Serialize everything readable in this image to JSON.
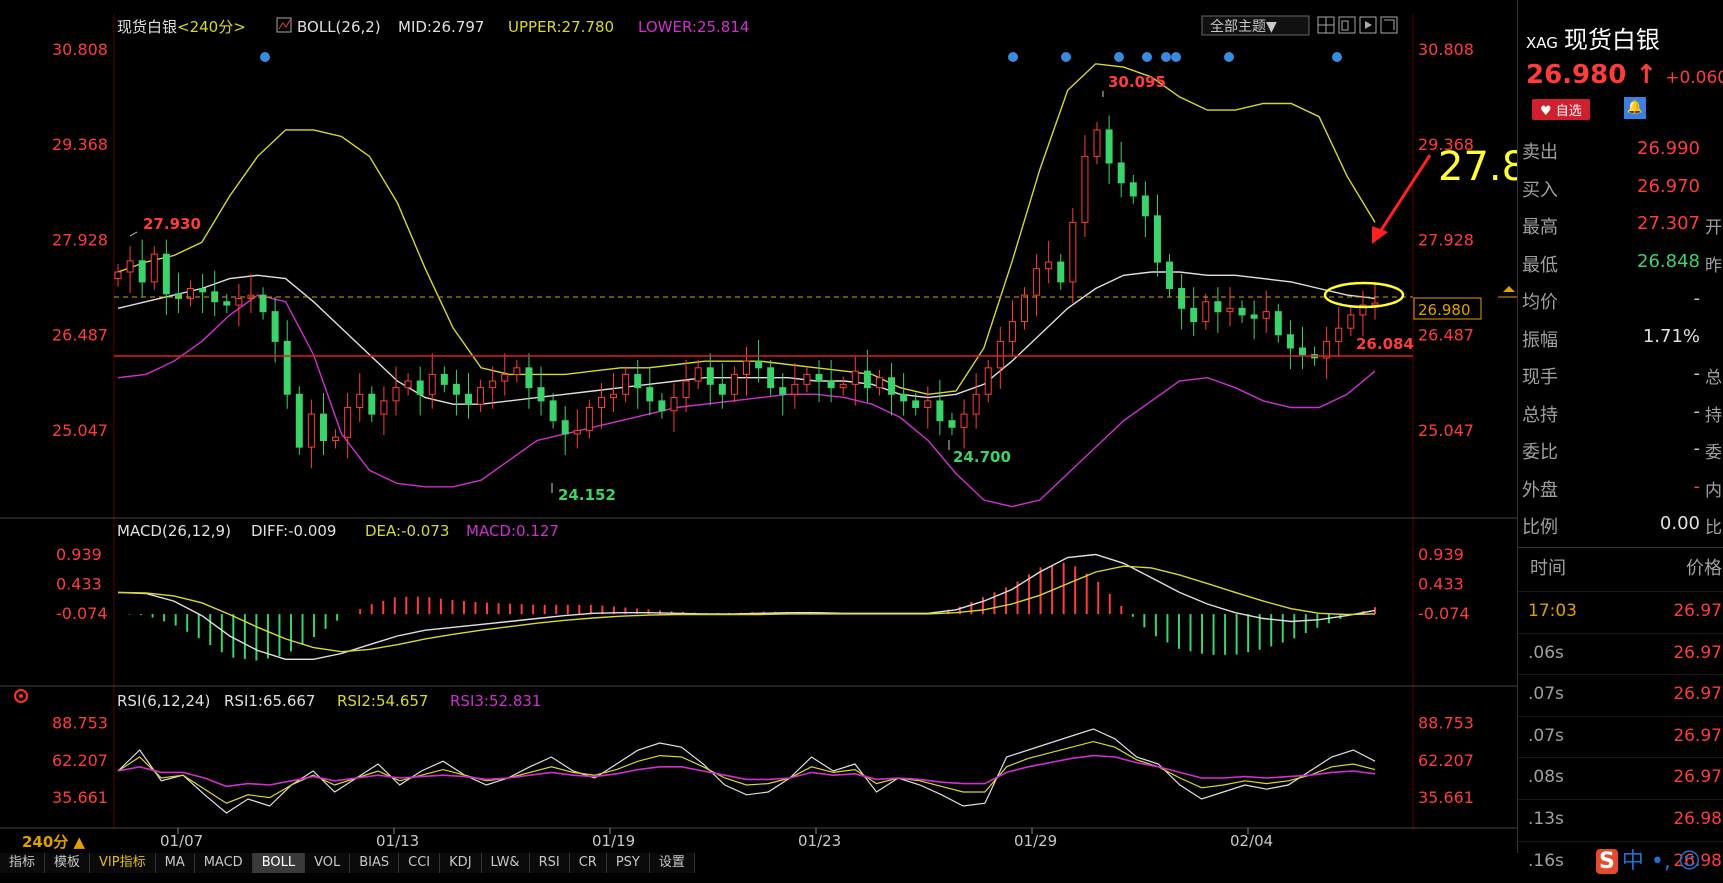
{
  "app": {
    "symbol_code": "XAG",
    "symbol_name": "现货白银",
    "period": "240分",
    "period_label": "<240分>"
  },
  "header_icons": [
    "boll-icon",
    "grid-icon",
    "window-icon",
    "play-icon",
    "expand-icon"
  ],
  "theme_button": "全部主题▼",
  "boll": {
    "label": "BOLL(26,2)",
    "mid": "MID:26.797",
    "upper": "UPPER:27.780",
    "lower": "LOWER:25.814"
  },
  "macd": {
    "label": "MACD(26,12,9)",
    "diff": "DIFF:-0.009",
    "dea": "DEA:-0.073",
    "macd": "MACD:0.127"
  },
  "rsi": {
    "label": "RSI(6,12,24)",
    "rsi1": "RSI1:65.667",
    "rsi2": "RSI2:54.657",
    "rsi3": "RSI3:52.831"
  },
  "period_button": "240分 ▲",
  "annotation": {
    "text": "27.8"
  },
  "tabs": [
    "指标",
    "模板",
    "VIP指标",
    "MA",
    "MACD",
    "BOLL",
    "VOL",
    "BIAS",
    "CCI",
    "KDJ",
    "LW&",
    "RSI",
    "CR",
    "PSY",
    "设置"
  ],
  "active_tab": "BOLL",
  "colors": {
    "up": "#ff3c3c",
    "down": "#3bd36a",
    "upper": "#d8d830",
    "lower": "#d030d0",
    "mid": "#e0e0e0",
    "support": "#e02020",
    "annotation": "#ffff33"
  },
  "chart_data": [
    {
      "type": "candlestick",
      "title": "现货白银<240分>",
      "x_labels": [
        "01/07",
        "01/13",
        "01/19",
        "01/23",
        "01/29",
        "02/04"
      ],
      "y_ticks": [
        "30.808",
        "29.368",
        "27.928",
        "26.487",
        "25.047"
      ],
      "ylim": [
        24.0,
        30.9
      ],
      "markers": {
        "high_27930": "27.930",
        "high_30095": "30.095",
        "low_24152": "24.152",
        "low_24700": "24.700",
        "support": "26.084",
        "current": "26.980"
      },
      "price_series": [
        27.45,
        27.62,
        27.3,
        27.72,
        27.12,
        27.05,
        27.2,
        27.15,
        27.0,
        26.95,
        27.05,
        27.1,
        26.85,
        26.4,
        25.6,
        24.8,
        25.3,
        24.9,
        24.95,
        25.4,
        25.6,
        25.3,
        25.5,
        25.7,
        25.8,
        25.6,
        25.9,
        25.75,
        25.6,
        25.45,
        25.7,
        25.8,
        25.9,
        26.0,
        25.7,
        25.5,
        25.2,
        25.0,
        25.05,
        25.4,
        25.55,
        25.6,
        25.9,
        25.7,
        25.5,
        25.35,
        25.55,
        25.8,
        26.0,
        25.75,
        25.6,
        25.9,
        26.1,
        26.0,
        25.7,
        25.6,
        25.75,
        25.9,
        25.8,
        25.7,
        25.75,
        25.95,
        25.7,
        25.85,
        25.6,
        25.5,
        25.4,
        25.5,
        25.2,
        25.1,
        25.3,
        25.6,
        26.0,
        26.4,
        26.7,
        27.1,
        27.5,
        27.6,
        27.3,
        28.2,
        29.2,
        29.6,
        29.1,
        28.8,
        28.6,
        28.3,
        27.6,
        27.2,
        26.9,
        26.7,
        27.0,
        26.85,
        26.9,
        26.8,
        26.75,
        26.85,
        26.5,
        26.3,
        26.2,
        26.15,
        26.4,
        26.6,
        26.8,
        26.95,
        26.98
      ],
      "boll_upper": [
        27.45,
        27.6,
        27.7,
        27.9,
        28.6,
        29.2,
        29.6,
        29.6,
        29.5,
        29.2,
        28.5,
        27.5,
        26.6,
        26.0,
        25.9,
        25.9,
        25.9,
        25.95,
        26.0,
        26.0,
        26.05,
        26.1,
        26.1,
        26.1,
        26.05,
        26.0,
        25.95,
        25.9,
        25.7,
        25.6,
        25.65,
        26.3,
        27.6,
        29.0,
        30.2,
        30.6,
        30.55,
        30.4,
        30.1,
        29.9,
        29.9,
        30.0,
        30.0,
        29.8,
        28.9,
        28.2
      ],
      "boll_mid": [
        26.9,
        27.0,
        27.1,
        27.2,
        27.35,
        27.4,
        27.35,
        27.0,
        26.6,
        26.2,
        25.8,
        25.55,
        25.45,
        25.45,
        25.5,
        25.55,
        25.6,
        25.65,
        25.7,
        25.75,
        25.8,
        25.85,
        25.85,
        25.85,
        25.85,
        25.8,
        25.8,
        25.75,
        25.6,
        25.55,
        25.6,
        25.75,
        26.1,
        26.5,
        26.9,
        27.2,
        27.4,
        27.45,
        27.45,
        27.4,
        27.4,
        27.35,
        27.3,
        27.2,
        27.1,
        27.05
      ],
      "boll_lower": [
        25.85,
        25.9,
        26.1,
        26.4,
        26.8,
        27.1,
        27.0,
        26.2,
        25.0,
        24.45,
        24.25,
        24.2,
        24.2,
        24.3,
        24.6,
        24.9,
        25.0,
        25.1,
        25.2,
        25.3,
        25.4,
        25.45,
        25.5,
        25.55,
        25.6,
        25.6,
        25.55,
        25.45,
        25.25,
        24.9,
        24.4,
        24.0,
        23.9,
        24.0,
        24.4,
        24.8,
        25.2,
        25.5,
        25.8,
        25.85,
        25.7,
        25.5,
        25.4,
        25.4,
        25.6,
        25.95
      ],
      "macd_ylim": [
        -1.0,
        1.2
      ],
      "macd_ticks": [
        "0.939",
        "0.433",
        "-0.074"
      ],
      "macd_diff": [
        0.3,
        0.28,
        0.15,
        -0.1,
        -0.45,
        -0.7,
        -0.85,
        -0.85,
        -0.75,
        -0.6,
        -0.45,
        -0.35,
        -0.3,
        -0.25,
        -0.2,
        -0.15,
        -0.1,
        -0.06,
        -0.05,
        -0.05,
        -0.06,
        -0.07,
        -0.07,
        -0.06,
        -0.05,
        -0.05,
        -0.06,
        -0.06,
        -0.06,
        -0.06,
        0.0,
        0.15,
        0.35,
        0.65,
        0.9,
        0.95,
        0.8,
        0.55,
        0.3,
        0.1,
        -0.05,
        -0.15,
        -0.2,
        -0.17,
        -0.1,
        -0.01
      ],
      "macd_dea": [
        0.3,
        0.29,
        0.24,
        0.12,
        -0.08,
        -0.3,
        -0.5,
        -0.65,
        -0.72,
        -0.68,
        -0.6,
        -0.5,
        -0.42,
        -0.35,
        -0.29,
        -0.23,
        -0.18,
        -0.14,
        -0.11,
        -0.09,
        -0.08,
        -0.08,
        -0.08,
        -0.08,
        -0.07,
        -0.07,
        -0.07,
        -0.07,
        -0.07,
        -0.07,
        -0.05,
        0.0,
        0.1,
        0.25,
        0.45,
        0.65,
        0.75,
        0.72,
        0.6,
        0.45,
        0.3,
        0.15,
        0.02,
        -0.06,
        -0.08,
        -0.07
      ],
      "rsi_ylim": [
        20,
        100
      ],
      "rsi_ticks": [
        "88.753",
        "62.207",
        "35.661"
      ],
      "rsi1": [
        55,
        70,
        48,
        52,
        38,
        25,
        35,
        30,
        45,
        55,
        40,
        50,
        60,
        45,
        55,
        62,
        52,
        45,
        50,
        58,
        65,
        55,
        50,
        60,
        70,
        75,
        72,
        60,
        45,
        38,
        40,
        50,
        65,
        55,
        60,
        40,
        50,
        45,
        38,
        30,
        32,
        65,
        70,
        75,
        80,
        85,
        78,
        65,
        60,
        45,
        35,
        40,
        45,
        42,
        45,
        55,
        65,
        70,
        62
      ],
      "rsi2": [
        55,
        65,
        50,
        52,
        42,
        32,
        38,
        36,
        45,
        52,
        45,
        50,
        55,
        48,
        52,
        56,
        52,
        48,
        50,
        54,
        58,
        54,
        52,
        56,
        62,
        66,
        65,
        58,
        50,
        45,
        46,
        50,
        58,
        54,
        56,
        46,
        50,
        48,
        44,
        40,
        40,
        58,
        64,
        68,
        72,
        76,
        72,
        63,
        58,
        50,
        43,
        45,
        48,
        46,
        48,
        52,
        58,
        60,
        56
      ],
      "rsi3": [
        55,
        58,
        54,
        54,
        50,
        44,
        46,
        45,
        48,
        51,
        48,
        50,
        52,
        50,
        51,
        52,
        51,
        49,
        50,
        52,
        54,
        52,
        51,
        53,
        56,
        58,
        58,
        55,
        52,
        49,
        49,
        50,
        54,
        52,
        53,
        49,
        50,
        49,
        47,
        46,
        46,
        54,
        58,
        61,
        64,
        66,
        65,
        61,
        58,
        54,
        50,
        50,
        51,
        50,
        51,
        52,
        54,
        55,
        53
      ]
    }
  ],
  "quote": {
    "price": "26.980",
    "arrow": "↑",
    "change": "+0.060",
    "fav_label": "♥ 自选",
    "rows": [
      {
        "key": "卖出",
        "value": "26.990",
        "extra": "",
        "color": "#ff3c3c"
      },
      {
        "key": "买入",
        "value": "26.970",
        "extra": "",
        "color": "#ff3c3c"
      },
      {
        "key": "最高",
        "value": "27.307",
        "extra": "开",
        "color": "#ff3c3c"
      },
      {
        "key": "最低",
        "value": "26.848",
        "extra": "昨",
        "color": "#3bd36a"
      },
      {
        "key": "均价",
        "value": "-",
        "extra": "",
        "color": "#c8c8c8"
      },
      {
        "key": "振幅",
        "value": "1.71%",
        "extra": "",
        "color": "#e0e0e0"
      },
      {
        "key": "现手",
        "value": "-",
        "extra": "总",
        "color": "#c8c8c8"
      },
      {
        "key": "总持",
        "value": "-",
        "extra": "持",
        "color": "#c8c8c8"
      },
      {
        "key": "委比",
        "value": "-",
        "extra": "委",
        "color": "#c8c8c8"
      },
      {
        "key": "外盘",
        "value": "-",
        "extra": "内",
        "color": "#ff3c3c"
      },
      {
        "key": "比例",
        "value": "0.00",
        "extra": "比",
        "color": "#e0e0e0"
      }
    ],
    "tick_header": {
      "time": "时间",
      "price": "价格"
    },
    "ticks": [
      {
        "time": "17:03",
        "price": "26.97"
      },
      {
        "time": ".06s",
        "price": "26.97"
      },
      {
        "time": ".07s",
        "price": "26.97"
      },
      {
        "time": ".07s",
        "price": "26.97"
      },
      {
        "time": ".08s",
        "price": "26.97"
      },
      {
        "time": ".13s",
        "price": "26.98"
      },
      {
        "time": ".16s",
        "price": "26.98"
      }
    ]
  },
  "ime": {
    "logo": "S",
    "text": "中 •, ☺"
  }
}
